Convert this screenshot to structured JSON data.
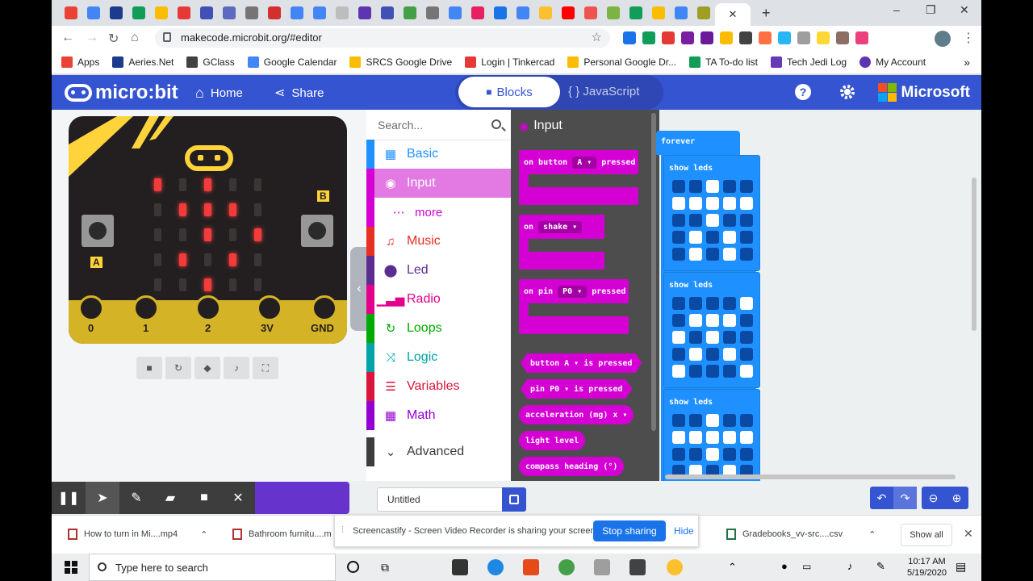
{
  "browser": {
    "url": "makecode.microbit.org/#editor",
    "bookmarks": [
      "Apps",
      "Aeries.Net",
      "GClass",
      "Google Calendar",
      "SRCS Google Drive",
      "Login | Tinkercad",
      "Personal Google Dr...",
      "TA To-do list",
      "Tech Jedi Log",
      "My Account"
    ],
    "win_min": "–",
    "win_max": "❐",
    "win_close": "✕",
    "new_tab": "+"
  },
  "header": {
    "logo": "micro:bit",
    "home": "Home",
    "share": "Share",
    "blocks": "Blocks",
    "javascript": "JavaScript",
    "brand": "Microsoft",
    "color": "#3454d1"
  },
  "simulator": {
    "pin_labels": [
      "0",
      "1",
      "2",
      "3V",
      "GND"
    ],
    "button_a": "A",
    "button_b": "B"
  },
  "toolbox": {
    "search_placeholder": "Search...",
    "categories": [
      {
        "label": "Basic",
        "color": "#1e90ff"
      },
      {
        "label": "Input",
        "color": "#d400d4"
      },
      {
        "label": "more",
        "color": "#d400d4"
      },
      {
        "label": "Music",
        "color": "#e63022"
      },
      {
        "label": "Led",
        "color": "#5c2d91"
      },
      {
        "label": "Radio",
        "color": "#e3008c"
      },
      {
        "label": "Loops",
        "color": "#00aa00"
      },
      {
        "label": "Logic",
        "color": "#00a4a6"
      },
      {
        "label": "Variables",
        "color": "#dc143c"
      },
      {
        "label": "Math",
        "color": "#9400d3"
      },
      {
        "label": "Advanced",
        "color": "#3c3c3c"
      }
    ]
  },
  "flyout": {
    "title": "Input",
    "blocks": [
      {
        "pre": "on button",
        "dd": "A ▾",
        "post": "pressed"
      },
      {
        "pre": "on",
        "dd": "shake ▾",
        "post": ""
      },
      {
        "pre": "on pin",
        "dd": "P0 ▾",
        "post": "pressed"
      }
    ],
    "reporters": [
      {
        "pre": "button",
        "dd": "A ▾",
        "post": "is pressed"
      },
      {
        "pre": "pin",
        "dd": "P0 ▾",
        "post": "is pressed"
      },
      {
        "pre": "acceleration (mg)",
        "dd": "x ▾",
        "post": ""
      },
      {
        "pre": "light level",
        "dd": "",
        "post": ""
      },
      {
        "pre": "compass heading (°)",
        "dd": "",
        "post": ""
      }
    ]
  },
  "workspace": {
    "forever": "forever",
    "show_leds": "show leds"
  },
  "bottom": {
    "project_name": "Untitled"
  },
  "sharing": {
    "message": "Screencastify - Screen Video Recorder is sharing your screen.",
    "stop": "Stop sharing",
    "hide": "Hide"
  },
  "downloads": {
    "items": [
      "How to turn in Mi....mp4",
      "Bathroom furnitu....m",
      "Gradebooks_vv-src....csv"
    ],
    "show_all": "Show all"
  },
  "taskbar": {
    "search": "Type here to search",
    "time": "10:17 AM",
    "date": "5/19/2020"
  }
}
